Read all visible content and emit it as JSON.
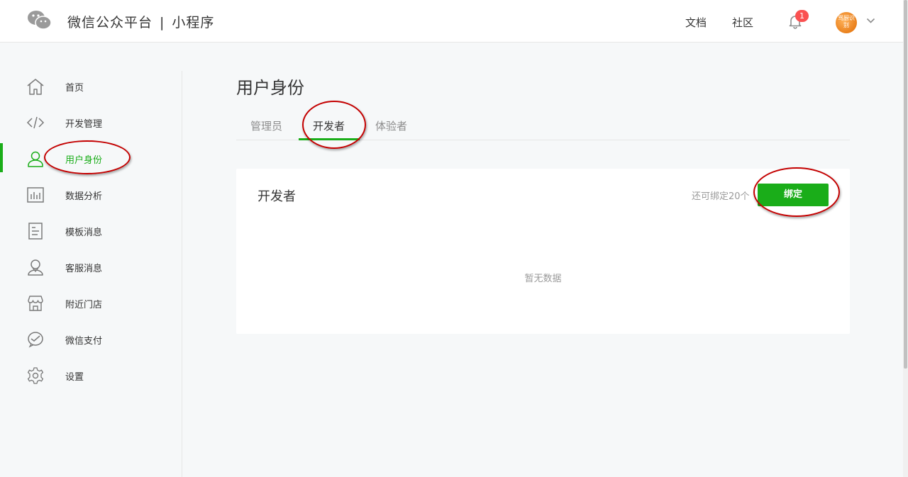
{
  "header": {
    "brand_name": "微信公众平台",
    "brand_sep": "|",
    "brand_product": "小程序",
    "links": {
      "docs": "文档",
      "community": "社区"
    },
    "notification_count": "1",
    "avatar_text": "骂厨识别"
  },
  "sidebar": {
    "items": [
      {
        "label": "首页",
        "icon": "home-icon"
      },
      {
        "label": "开发管理",
        "icon": "code-icon"
      },
      {
        "label": "用户身份",
        "icon": "user-icon"
      },
      {
        "label": "数据分析",
        "icon": "chart-icon"
      },
      {
        "label": "模板消息",
        "icon": "document-icon"
      },
      {
        "label": "客服消息",
        "icon": "customer-service-icon"
      },
      {
        "label": "附近门店",
        "icon": "store-icon"
      },
      {
        "label": "微信支付",
        "icon": "wechat-pay-icon"
      },
      {
        "label": "设置",
        "icon": "gear-icon"
      }
    ],
    "active_index": 2
  },
  "main": {
    "title": "用户身份",
    "tabs": [
      {
        "label": "管理员"
      },
      {
        "label": "开发者"
      },
      {
        "label": "体验者"
      }
    ],
    "active_tab": 1,
    "card": {
      "title": "开发者",
      "remaining": "还可绑定20个",
      "bind_label": "绑定",
      "empty_text": "暂无数据"
    }
  },
  "colors": {
    "accent": "#1aad19",
    "badge": "#fa5151",
    "annotation": "#c40000"
  }
}
